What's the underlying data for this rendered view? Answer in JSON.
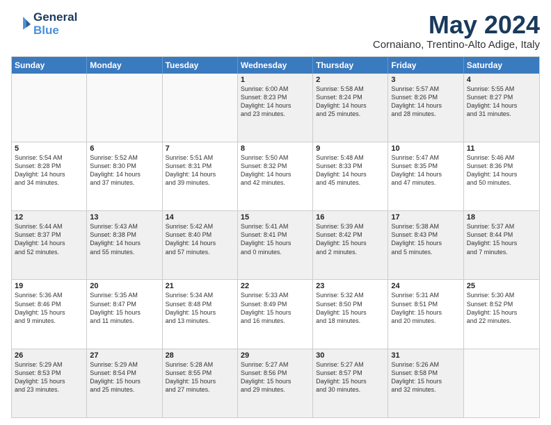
{
  "logo": {
    "line1": "General",
    "line2": "Blue"
  },
  "title": "May 2024",
  "location": "Cornaiano, Trentino-Alto Adige, Italy",
  "header_days": [
    "Sunday",
    "Monday",
    "Tuesday",
    "Wednesday",
    "Thursday",
    "Friday",
    "Saturday"
  ],
  "weeks": [
    [
      {
        "day": "",
        "info": ""
      },
      {
        "day": "",
        "info": ""
      },
      {
        "day": "",
        "info": ""
      },
      {
        "day": "1",
        "info": "Sunrise: 6:00 AM\nSunset: 8:23 PM\nDaylight: 14 hours\nand 23 minutes."
      },
      {
        "day": "2",
        "info": "Sunrise: 5:58 AM\nSunset: 8:24 PM\nDaylight: 14 hours\nand 25 minutes."
      },
      {
        "day": "3",
        "info": "Sunrise: 5:57 AM\nSunset: 8:26 PM\nDaylight: 14 hours\nand 28 minutes."
      },
      {
        "day": "4",
        "info": "Sunrise: 5:55 AM\nSunset: 8:27 PM\nDaylight: 14 hours\nand 31 minutes."
      }
    ],
    [
      {
        "day": "5",
        "info": "Sunrise: 5:54 AM\nSunset: 8:28 PM\nDaylight: 14 hours\nand 34 minutes."
      },
      {
        "day": "6",
        "info": "Sunrise: 5:52 AM\nSunset: 8:30 PM\nDaylight: 14 hours\nand 37 minutes."
      },
      {
        "day": "7",
        "info": "Sunrise: 5:51 AM\nSunset: 8:31 PM\nDaylight: 14 hours\nand 39 minutes."
      },
      {
        "day": "8",
        "info": "Sunrise: 5:50 AM\nSunset: 8:32 PM\nDaylight: 14 hours\nand 42 minutes."
      },
      {
        "day": "9",
        "info": "Sunrise: 5:48 AM\nSunset: 8:33 PM\nDaylight: 14 hours\nand 45 minutes."
      },
      {
        "day": "10",
        "info": "Sunrise: 5:47 AM\nSunset: 8:35 PM\nDaylight: 14 hours\nand 47 minutes."
      },
      {
        "day": "11",
        "info": "Sunrise: 5:46 AM\nSunset: 8:36 PM\nDaylight: 14 hours\nand 50 minutes."
      }
    ],
    [
      {
        "day": "12",
        "info": "Sunrise: 5:44 AM\nSunset: 8:37 PM\nDaylight: 14 hours\nand 52 minutes."
      },
      {
        "day": "13",
        "info": "Sunrise: 5:43 AM\nSunset: 8:38 PM\nDaylight: 14 hours\nand 55 minutes."
      },
      {
        "day": "14",
        "info": "Sunrise: 5:42 AM\nSunset: 8:40 PM\nDaylight: 14 hours\nand 57 minutes."
      },
      {
        "day": "15",
        "info": "Sunrise: 5:41 AM\nSunset: 8:41 PM\nDaylight: 15 hours\nand 0 minutes."
      },
      {
        "day": "16",
        "info": "Sunrise: 5:39 AM\nSunset: 8:42 PM\nDaylight: 15 hours\nand 2 minutes."
      },
      {
        "day": "17",
        "info": "Sunrise: 5:38 AM\nSunset: 8:43 PM\nDaylight: 15 hours\nand 5 minutes."
      },
      {
        "day": "18",
        "info": "Sunrise: 5:37 AM\nSunset: 8:44 PM\nDaylight: 15 hours\nand 7 minutes."
      }
    ],
    [
      {
        "day": "19",
        "info": "Sunrise: 5:36 AM\nSunset: 8:46 PM\nDaylight: 15 hours\nand 9 minutes."
      },
      {
        "day": "20",
        "info": "Sunrise: 5:35 AM\nSunset: 8:47 PM\nDaylight: 15 hours\nand 11 minutes."
      },
      {
        "day": "21",
        "info": "Sunrise: 5:34 AM\nSunset: 8:48 PM\nDaylight: 15 hours\nand 13 minutes."
      },
      {
        "day": "22",
        "info": "Sunrise: 5:33 AM\nSunset: 8:49 PM\nDaylight: 15 hours\nand 16 minutes."
      },
      {
        "day": "23",
        "info": "Sunrise: 5:32 AM\nSunset: 8:50 PM\nDaylight: 15 hours\nand 18 minutes."
      },
      {
        "day": "24",
        "info": "Sunrise: 5:31 AM\nSunset: 8:51 PM\nDaylight: 15 hours\nand 20 minutes."
      },
      {
        "day": "25",
        "info": "Sunrise: 5:30 AM\nSunset: 8:52 PM\nDaylight: 15 hours\nand 22 minutes."
      }
    ],
    [
      {
        "day": "26",
        "info": "Sunrise: 5:29 AM\nSunset: 8:53 PM\nDaylight: 15 hours\nand 23 minutes."
      },
      {
        "day": "27",
        "info": "Sunrise: 5:29 AM\nSunset: 8:54 PM\nDaylight: 15 hours\nand 25 minutes."
      },
      {
        "day": "28",
        "info": "Sunrise: 5:28 AM\nSunset: 8:55 PM\nDaylight: 15 hours\nand 27 minutes."
      },
      {
        "day": "29",
        "info": "Sunrise: 5:27 AM\nSunset: 8:56 PM\nDaylight: 15 hours\nand 29 minutes."
      },
      {
        "day": "30",
        "info": "Sunrise: 5:27 AM\nSunset: 8:57 PM\nDaylight: 15 hours\nand 30 minutes."
      },
      {
        "day": "31",
        "info": "Sunrise: 5:26 AM\nSunset: 8:58 PM\nDaylight: 15 hours\nand 32 minutes."
      },
      {
        "day": "",
        "info": ""
      }
    ]
  ]
}
